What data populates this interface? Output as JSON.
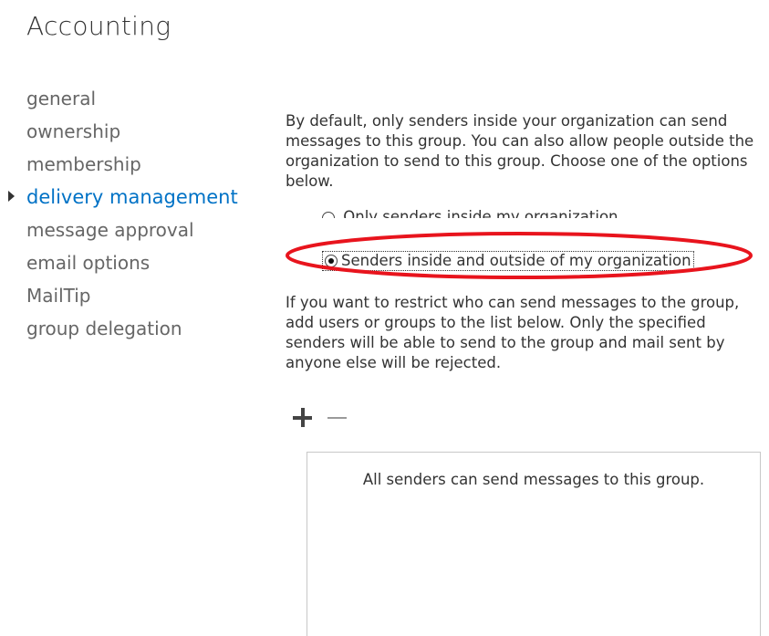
{
  "page": {
    "title": "Accounting"
  },
  "nav": {
    "items": [
      {
        "label": "general"
      },
      {
        "label": "ownership"
      },
      {
        "label": "membership"
      },
      {
        "label": "delivery management",
        "active": true
      },
      {
        "label": "message approval"
      },
      {
        "label": "email options"
      },
      {
        "label": "MailTip"
      },
      {
        "label": "group delegation"
      }
    ]
  },
  "delivery": {
    "intro_text": "By default, only senders inside your organization can send messages to this group. You can also allow people outside the organization to send to this group. Choose one of the options below.",
    "options": [
      {
        "label": "Only senders inside my organization",
        "selected": false
      },
      {
        "label": "Senders inside and outside of my organization",
        "selected": true
      }
    ],
    "restrict_text": "If you want to restrict who can send messages to the group, add users or groups to the list below. Only the specified senders will be able to send to the group and mail sent by anyone else will be rejected.",
    "toolbar": {
      "add_icon": "plus-icon",
      "remove_icon": "minus-icon"
    },
    "list_empty_text": "All senders can send messages to this group."
  },
  "colors": {
    "accent": "#0072c6",
    "annotation": "#e8141d",
    "text": "#333333"
  }
}
